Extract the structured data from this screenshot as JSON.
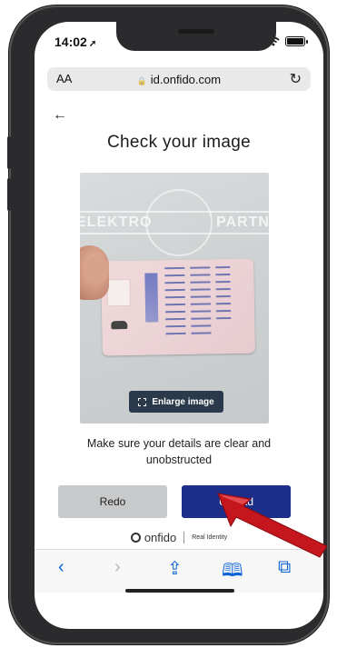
{
  "status_bar": {
    "time": "14:02",
    "location_glyph": "➚"
  },
  "address_bar": {
    "text_size_label": "AA",
    "url": "id.onfido.com",
    "lock_glyph": "🔒",
    "reload_glyph": "↻"
  },
  "page": {
    "back_glyph": "←",
    "title": "Check your image",
    "watermark_left": "ELEKTRO",
    "watermark_right": "PARTNER",
    "enlarge_label": "Enlarge image",
    "hint": "Make sure your details are clear and unobstructed",
    "redo_label": "Redo",
    "upload_label": "Upload"
  },
  "branding": {
    "name": "onfido",
    "tagline": "Real Identity"
  },
  "toolbar": {
    "back_glyph": "‹",
    "forward_glyph": "›",
    "share_glyph": "⇪",
    "bookmarks_glyph": "🕮",
    "tabs_glyph": "⧉"
  },
  "colors": {
    "upload_button": "#1c2d8a",
    "redo_button": "#c8c9ca",
    "safari_blue": "#0a63d8",
    "arrow_red": "#c4161c"
  }
}
